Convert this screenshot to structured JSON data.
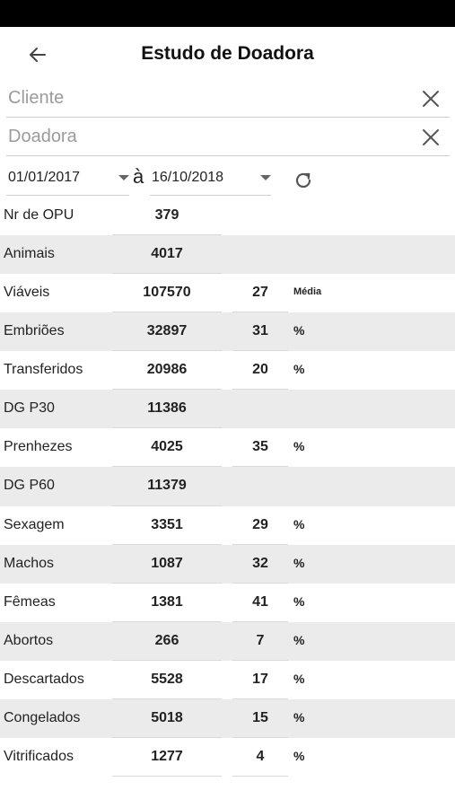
{
  "header": {
    "title": "Estudo de Doadora"
  },
  "filters": {
    "cliente_placeholder": "Cliente",
    "doadora_placeholder": "Doadora"
  },
  "date_range": {
    "from": "01/01/2017",
    "separator": "à",
    "to": "16/10/2018"
  },
  "stats": [
    {
      "label": "Nr de OPU",
      "count": "379",
      "pct": "",
      "unit": ""
    },
    {
      "label": "Animais",
      "count": "4017",
      "pct": "",
      "unit": ""
    },
    {
      "label": "Viáveis",
      "count": "107570",
      "pct": "27",
      "unit": "Média"
    },
    {
      "label": "Embriões",
      "count": "32897",
      "pct": "31",
      "unit": "%"
    },
    {
      "label": "Transferidos",
      "count": "20986",
      "pct": "20",
      "unit": "%"
    },
    {
      "label": "DG P30",
      "count": "11386",
      "pct": "",
      "unit": ""
    },
    {
      "label": "Prenhezes",
      "count": "4025",
      "pct": "35",
      "unit": "%"
    },
    {
      "label": "DG P60",
      "count": "11379",
      "pct": "",
      "unit": ""
    },
    {
      "label": "Sexagem",
      "count": "3351",
      "pct": "29",
      "unit": "%"
    },
    {
      "label": "Machos",
      "count": "1087",
      "pct": "32",
      "unit": "%"
    },
    {
      "label": "Fêmeas",
      "count": "1381",
      "pct": "41",
      "unit": "%"
    },
    {
      "label": "Abortos",
      "count": "266",
      "pct": "7",
      "unit": "%"
    },
    {
      "label": "Descartados",
      "count": "5528",
      "pct": "17",
      "unit": "%"
    },
    {
      "label": "Congelados",
      "count": "5018",
      "pct": "15",
      "unit": "%"
    },
    {
      "label": "Vitrificados",
      "count": "1277",
      "pct": "4",
      "unit": "%"
    }
  ],
  "icons": {
    "back": "arrow-left-icon",
    "clear": "close-icon",
    "refresh": "refresh-icon",
    "dropdown": "caret-down-icon"
  },
  "colors": {
    "shaded_row": "#ebebeb",
    "statusbar": "#000000"
  }
}
